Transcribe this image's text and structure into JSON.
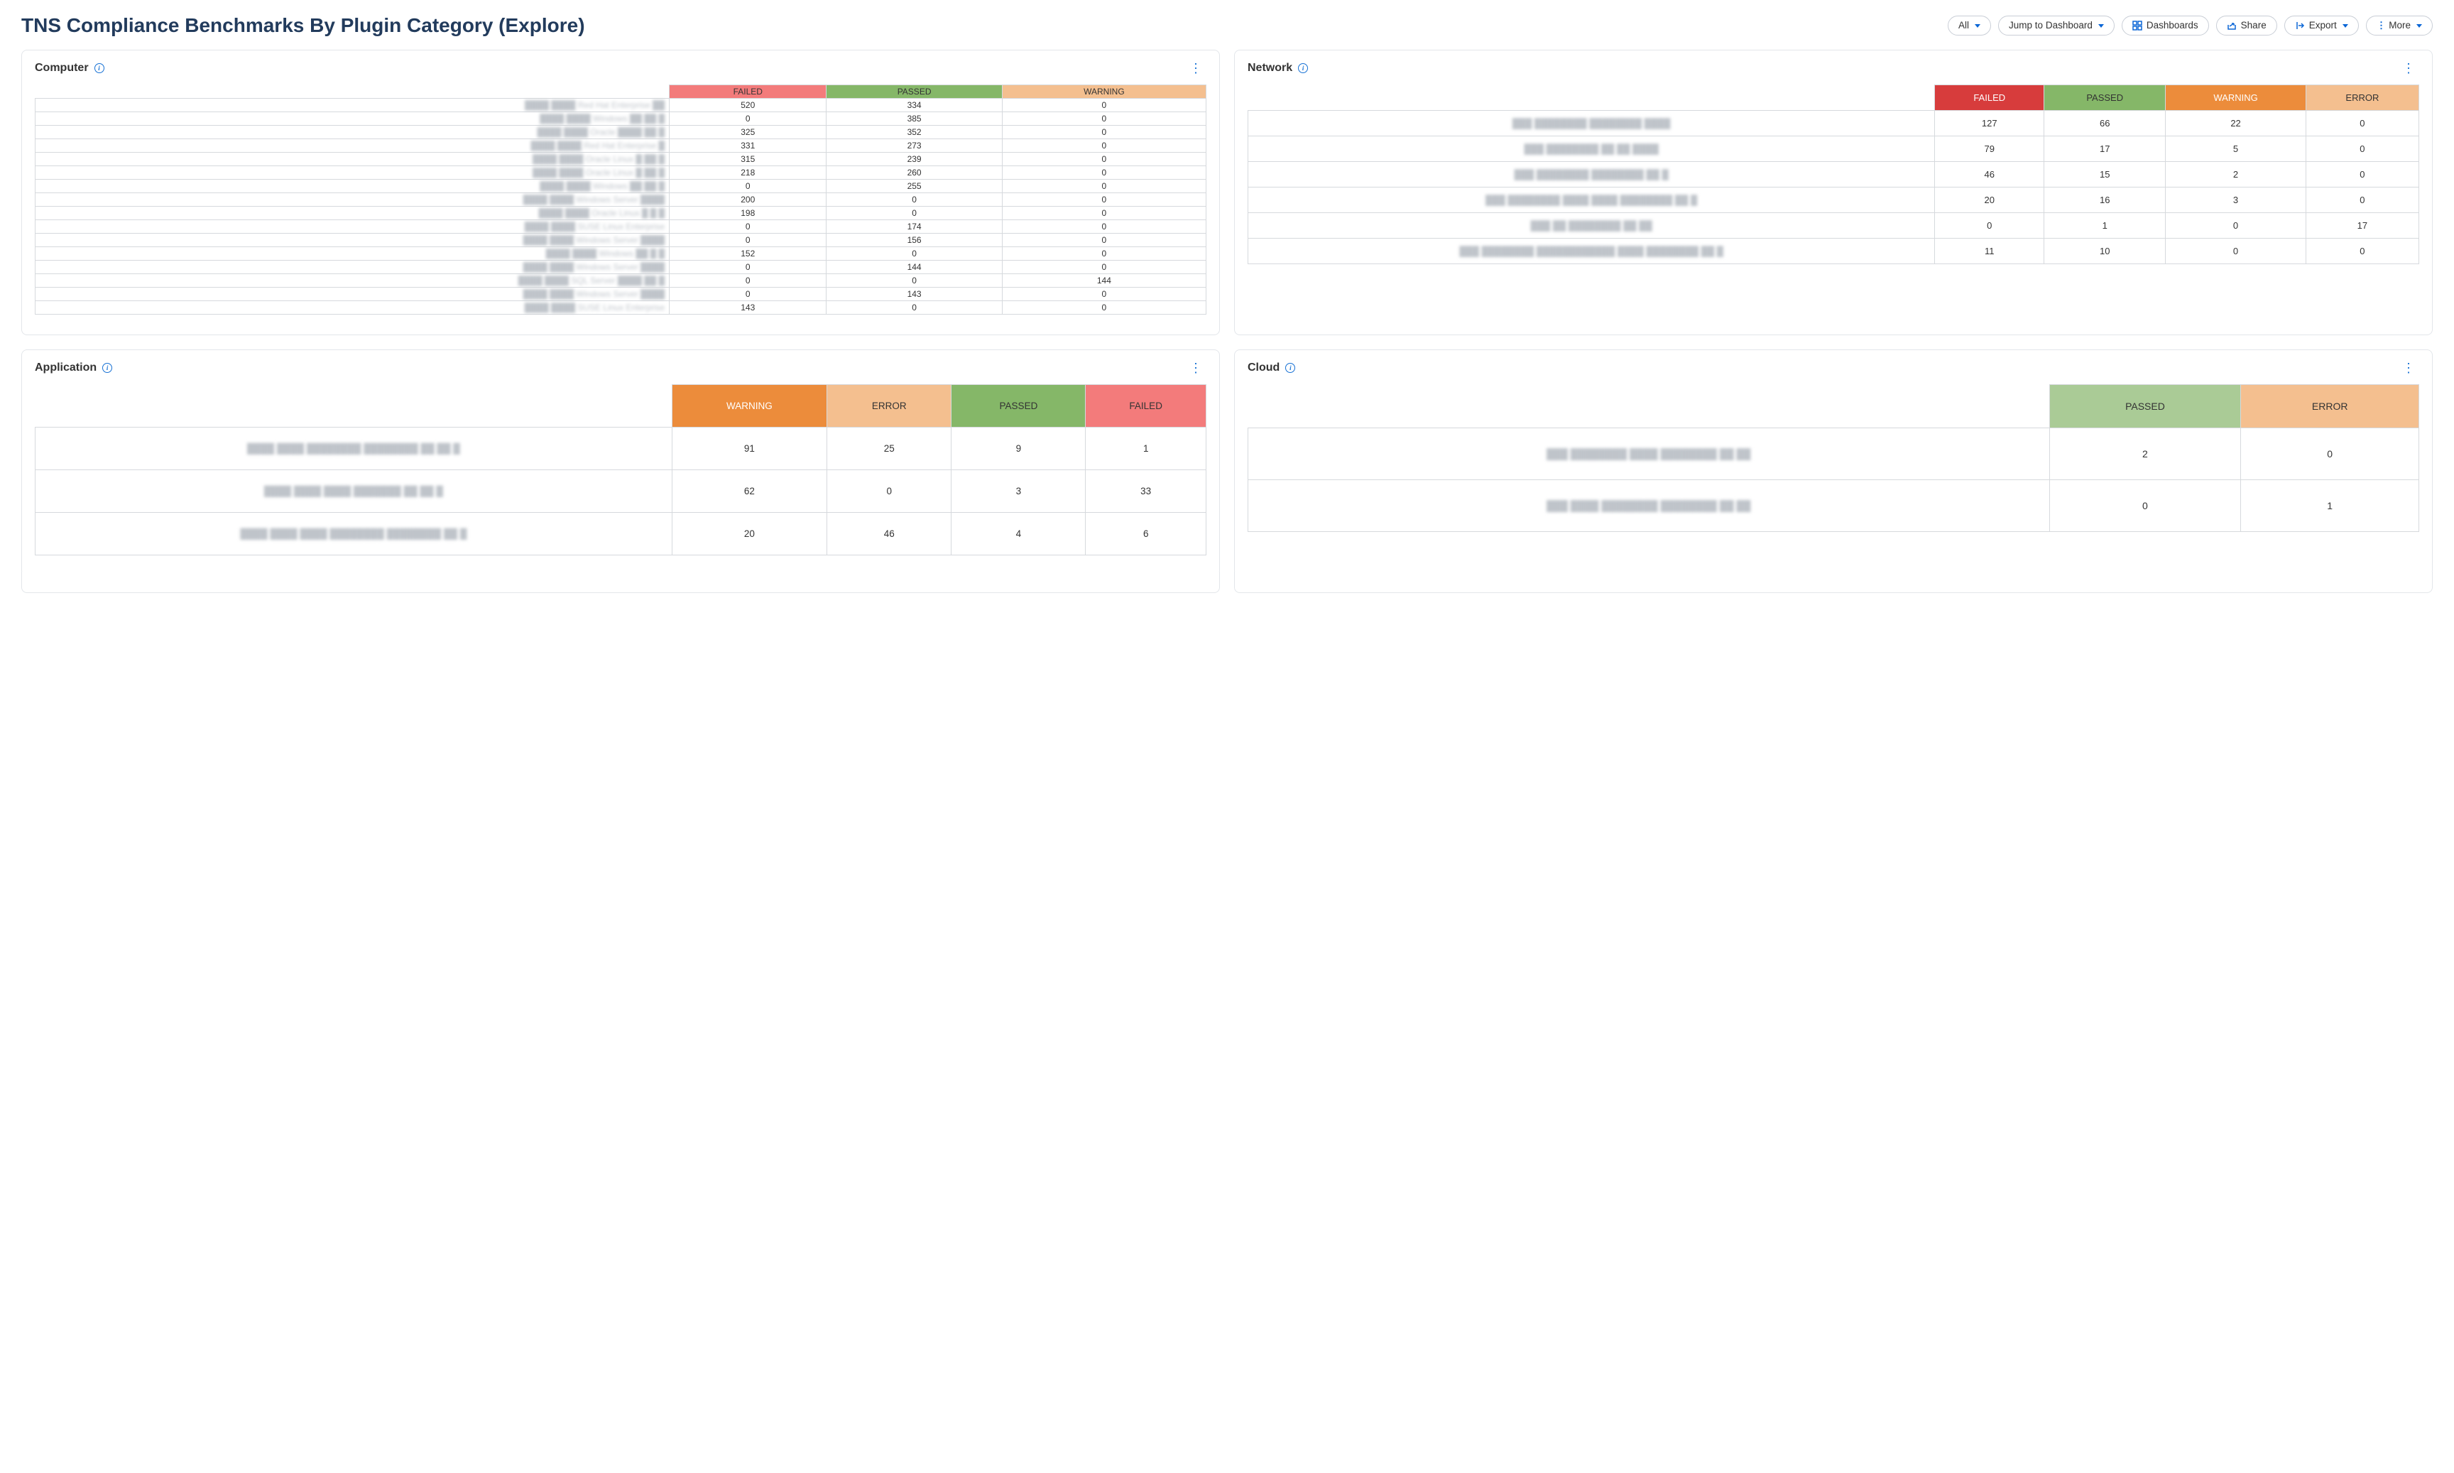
{
  "header": {
    "title": "TNS Compliance Benchmarks By Plugin Category (Explore)",
    "buttons": {
      "all": "All",
      "jump": "Jump to Dashboard",
      "dashboards": "Dashboards",
      "share": "Share",
      "export": "Export",
      "more": "More"
    }
  },
  "panels": {
    "computer": {
      "title": "Computer",
      "columns": [
        "FAILED",
        "PASSED",
        "WARNING"
      ],
      "column_styles": [
        "hdr-failed-soft",
        "hdr-passed",
        "hdr-warning-soft"
      ],
      "rows": [
        {
          "label": "████ ████ Red Hat Enterprise ██",
          "values": [
            520,
            334,
            0
          ]
        },
        {
          "label": "████ ████ Windows ██ ██ █",
          "values": [
            0,
            385,
            0
          ]
        },
        {
          "label": "████ ████ Oracle ████ ██ █",
          "values": [
            325,
            352,
            0
          ]
        },
        {
          "label": "████ ████ Red Hat Enterprise █",
          "values": [
            331,
            273,
            0
          ]
        },
        {
          "label": "████ ████ Oracle Linux █ ██ █",
          "values": [
            315,
            239,
            0
          ]
        },
        {
          "label": "████ ████ Oracle Linux █ ██ █",
          "values": [
            218,
            260,
            0
          ]
        },
        {
          "label": "████ ████ Windows ██ ██ █",
          "values": [
            0,
            255,
            0
          ]
        },
        {
          "label": "████ ████ Windows Server ████",
          "values": [
            200,
            0,
            0
          ]
        },
        {
          "label": "████ ████ Oracle Linux █ █ █",
          "values": [
            198,
            0,
            0
          ]
        },
        {
          "label": "████ ████ SUSE Linux Enterprise",
          "values": [
            0,
            174,
            0
          ]
        },
        {
          "label": "████ ████ Windows Server ████",
          "values": [
            0,
            156,
            0
          ]
        },
        {
          "label": "████ ████ Windows ██ █ █",
          "values": [
            152,
            0,
            0
          ]
        },
        {
          "label": "████ ████ Windows Server ████",
          "values": [
            0,
            144,
            0
          ]
        },
        {
          "label": "████ ████ SQL Server ████ ██ █",
          "values": [
            0,
            0,
            144
          ]
        },
        {
          "label": "████ ████ Windows Server ████",
          "values": [
            0,
            143,
            0
          ]
        },
        {
          "label": "████ ████ SUSE Linux Enterprise",
          "values": [
            143,
            0,
            0
          ]
        }
      ]
    },
    "network": {
      "title": "Network",
      "columns": [
        "FAILED",
        "PASSED",
        "WARNING",
        "ERROR"
      ],
      "column_styles": [
        "hdr-failed",
        "hdr-passed",
        "hdr-warning",
        "hdr-error"
      ],
      "rows": [
        {
          "label": "███ ████████ ████████ ████",
          "values": [
            127,
            66,
            22,
            0
          ]
        },
        {
          "label": "███ ████████ ██ ██ ████",
          "values": [
            79,
            17,
            5,
            0
          ]
        },
        {
          "label": "███ ████████ ████████ ██ █",
          "values": [
            46,
            15,
            2,
            0
          ]
        },
        {
          "label": "███ ████████ ████ ████ ████████ ██ █",
          "values": [
            20,
            16,
            3,
            0
          ]
        },
        {
          "label": "███ ██ ████████ ██ ██",
          "values": [
            0,
            1,
            0,
            17
          ]
        },
        {
          "label": "███ ████████ ████████████ ████ ████████ ██ █",
          "values": [
            11,
            10,
            0,
            0
          ]
        }
      ]
    },
    "application": {
      "title": "Application",
      "columns": [
        "WARNING",
        "ERROR",
        "PASSED",
        "FAILED"
      ],
      "column_styles": [
        "hdr-warning",
        "hdr-error",
        "hdr-passed",
        "hdr-failed-soft"
      ],
      "rows": [
        {
          "label": "████ ████ ████████ ████████ ██ ██ █",
          "values": [
            91,
            25,
            9,
            1
          ]
        },
        {
          "label": "████ ████ ████ ███████ ██ ██ █",
          "values": [
            62,
            0,
            3,
            33
          ]
        },
        {
          "label": "████ ████ ████ ████████ ████████ ██ █",
          "values": [
            20,
            46,
            4,
            6
          ]
        }
      ]
    },
    "cloud": {
      "title": "Cloud",
      "columns": [
        "PASSED",
        "ERROR"
      ],
      "column_styles": [
        "hdr-passed-soft",
        "hdr-error"
      ],
      "rows": [
        {
          "label": "███ ████████ ████ ████████ ██ ██",
          "values": [
            2,
            0
          ]
        },
        {
          "label": "███ ████ ████████ ████████ ██ ██",
          "values": [
            0,
            1
          ]
        }
      ]
    }
  },
  "chart_data": [
    {
      "type": "table",
      "title": "Computer",
      "columns": [
        "FAILED",
        "PASSED",
        "WARNING"
      ],
      "rows": [
        [
          520,
          334,
          0
        ],
        [
          0,
          385,
          0
        ],
        [
          325,
          352,
          0
        ],
        [
          331,
          273,
          0
        ],
        [
          315,
          239,
          0
        ],
        [
          218,
          260,
          0
        ],
        [
          0,
          255,
          0
        ],
        [
          200,
          0,
          0
        ],
        [
          198,
          0,
          0
        ],
        [
          0,
          174,
          0
        ],
        [
          0,
          156,
          0
        ],
        [
          152,
          0,
          0
        ],
        [
          0,
          144,
          0
        ],
        [
          0,
          0,
          144
        ],
        [
          0,
          143,
          0
        ],
        [
          143,
          0,
          0
        ]
      ]
    },
    {
      "type": "table",
      "title": "Network",
      "columns": [
        "FAILED",
        "PASSED",
        "WARNING",
        "ERROR"
      ],
      "rows": [
        [
          127,
          66,
          22,
          0
        ],
        [
          79,
          17,
          5,
          0
        ],
        [
          46,
          15,
          2,
          0
        ],
        [
          20,
          16,
          3,
          0
        ],
        [
          0,
          1,
          0,
          17
        ],
        [
          11,
          10,
          0,
          0
        ]
      ]
    },
    {
      "type": "table",
      "title": "Application",
      "columns": [
        "WARNING",
        "ERROR",
        "PASSED",
        "FAILED"
      ],
      "rows": [
        [
          91,
          25,
          9,
          1
        ],
        [
          62,
          0,
          3,
          33
        ],
        [
          20,
          46,
          4,
          6
        ]
      ]
    },
    {
      "type": "table",
      "title": "Cloud",
      "columns": [
        "PASSED",
        "ERROR"
      ],
      "rows": [
        [
          2,
          0
        ],
        [
          0,
          1
        ]
      ]
    }
  ]
}
